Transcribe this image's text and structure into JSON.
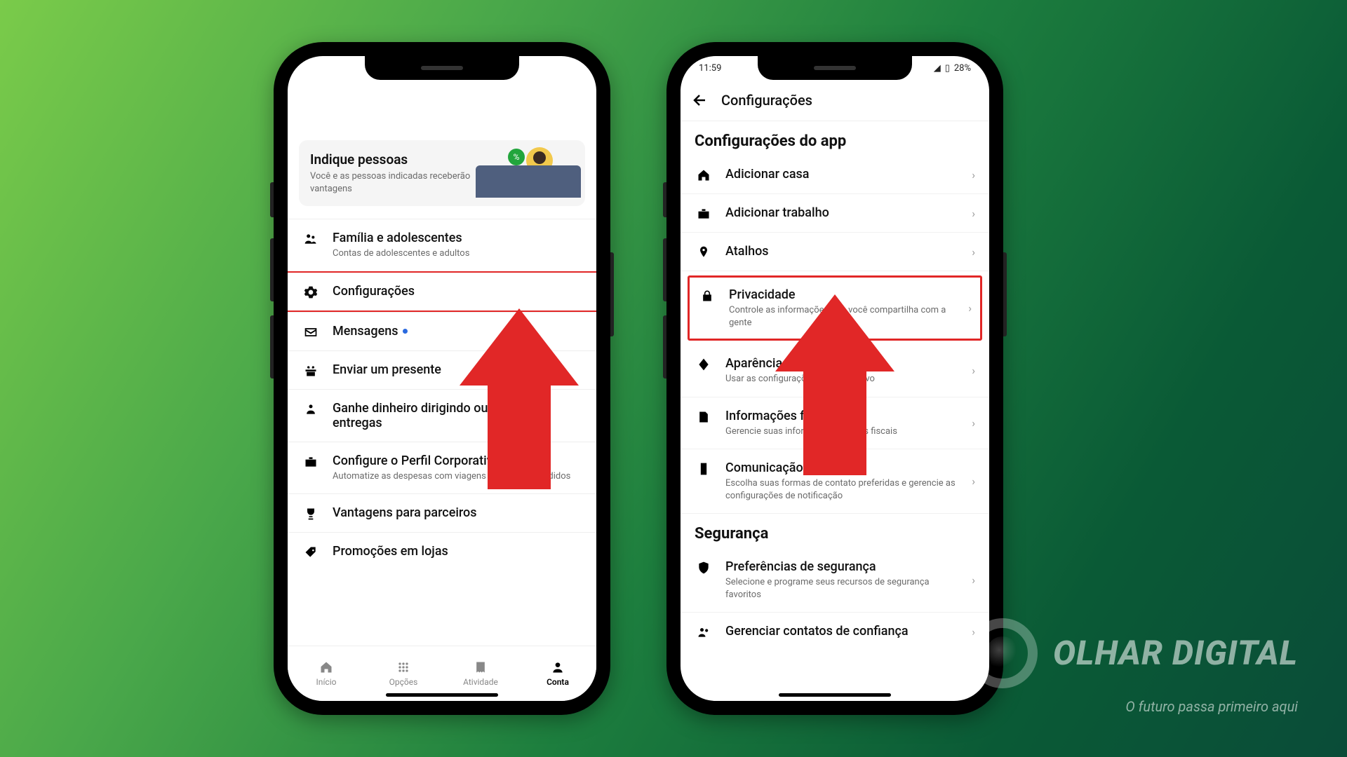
{
  "brand": {
    "name": "OLHAR DIGITAL",
    "tagline": "O futuro passa primeiro aqui"
  },
  "phone1": {
    "promo": {
      "title": "Indique pessoas",
      "subtitle": "Você e as pessoas indicadas receberão vantagens",
      "badge_icon": "percent"
    },
    "items": [
      {
        "icon": "family",
        "label": "Família e adolescentes",
        "sub": "Contas de adolescentes e adultos"
      },
      {
        "icon": "gear",
        "label": "Configurações",
        "highlight": true
      },
      {
        "icon": "mail",
        "label": "Mensagens",
        "unread": true
      },
      {
        "icon": "gift",
        "label": "Enviar um presente"
      },
      {
        "icon": "driver",
        "label": "Ganhe dinheiro dirigindo ou fazendo entregas"
      },
      {
        "icon": "briefcase",
        "label": "Configure o Perfil Corporativo",
        "sub": "Automatize as despesas com viagens a trabalho e pedidos"
      },
      {
        "icon": "trophy",
        "label": "Vantagens para parceiros"
      },
      {
        "icon": "tag",
        "label": "Promoções em lojas"
      }
    ],
    "tabs": [
      {
        "icon": "home",
        "label": "Início"
      },
      {
        "icon": "grid",
        "label": "Opções"
      },
      {
        "icon": "receipt",
        "label": "Atividade"
      },
      {
        "icon": "person",
        "label": "Conta",
        "active": true
      }
    ]
  },
  "phone2": {
    "status": {
      "time": "11:59",
      "battery": "28%"
    },
    "appbar_title": "Configurações",
    "section1": "Configurações do app",
    "items": [
      {
        "icon": "home",
        "label": "Adicionar casa"
      },
      {
        "icon": "briefcase",
        "label": "Adicionar trabalho"
      },
      {
        "icon": "pin",
        "label": "Atalhos"
      },
      {
        "icon": "lock",
        "label": "Privacidade",
        "sub": "Controle as informações que você compartilha com a gente",
        "boxed": true
      },
      {
        "icon": "diamond",
        "label": "Aparência",
        "sub": "Usar as configurações do dispositivo"
      },
      {
        "icon": "doc",
        "label": "Informações fiscais",
        "sub": "Gerencie suas informações e notas fiscais"
      },
      {
        "icon": "phone",
        "label": "Comunicação",
        "sub": "Escolha suas formas de contato preferidas e gerencie as configurações de notificação"
      }
    ],
    "section2": "Segurança",
    "items2": [
      {
        "icon": "shield",
        "label": "Preferências de segurança",
        "sub": "Selecione e programe seus recursos de segurança favoritos"
      },
      {
        "icon": "contacts",
        "label": "Gerenciar contatos de confiança"
      }
    ]
  }
}
